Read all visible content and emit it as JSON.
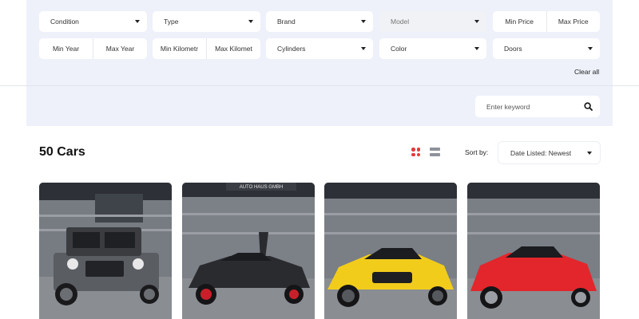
{
  "filters": {
    "condition": "Condition",
    "type": "Type",
    "brand": "Brand",
    "model": "Model",
    "min_price": "Min Price",
    "max_price": "Max Price",
    "min_year": "Min Year",
    "max_year": "Max Year",
    "min_kilometer": "Min Kilometr",
    "max_kilometer": "Max Kilomet",
    "cylinders": "Cylinders",
    "color": "Color",
    "doors": "Doors",
    "clear_all": "Clear all"
  },
  "search": {
    "placeholder": "Enter keyword"
  },
  "results": {
    "count_label": "50 Cars",
    "sort_label": "Sort by:",
    "sort_value": "Date Listed: Newest"
  },
  "view_modes": {
    "active": "grid"
  },
  "colors": {
    "accent": "#e43b3b",
    "panel": "#eef1fa"
  },
  "listings": [
    {
      "car_color": "#5a5d62",
      "dealer_sign": ""
    },
    {
      "car_color": "#2a2b2e",
      "dealer_sign": "AUTO HAUS GMBH"
    },
    {
      "car_color": "#f2cc1b",
      "dealer_sign": ""
    },
    {
      "car_color": "#e2262c",
      "dealer_sign": ""
    }
  ]
}
